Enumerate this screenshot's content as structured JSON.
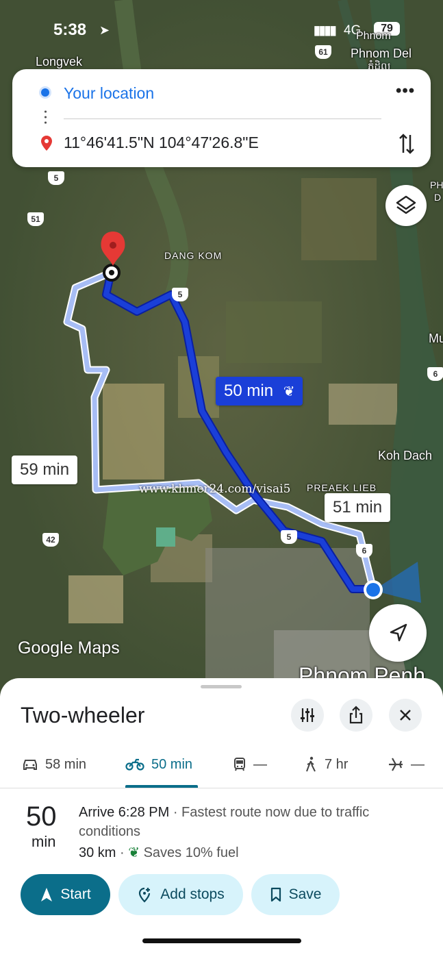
{
  "status_bar": {
    "time": "5:38",
    "network": "4G",
    "battery": "79"
  },
  "search": {
    "origin": "Your location",
    "destination": "11°46'41.5\"N 104°47'26.8\"E"
  },
  "map": {
    "places": {
      "longvek": "Longvek",
      "phnom_del": "Phnom Del",
      "phnom_del_khmer": "ភ្នំដិល",
      "phnom_top": "Phnom",
      "dang_kom": "DANG KOM",
      "koh_dach": "Koh Dach",
      "preaek_lieb": "PREAEK LIEB",
      "edge_ph": "PH",
      "edge_d": "D",
      "edge_mu": "Mu",
      "phnom_penh": "Phnom Penh"
    },
    "road_shields": {
      "r61": "61",
      "r5a": "5",
      "r51": "51",
      "r5b": "5",
      "r6a": "6",
      "r42": "42",
      "r5c": "5",
      "r6b": "6"
    },
    "route_times": {
      "main": "50 min",
      "alt1": "59 min",
      "alt2": "51 min"
    },
    "watermark": "www.khmer24.com/visai5",
    "logo": "Google Maps",
    "colors": {
      "main_route": "#1a3fd8",
      "alt_route": "#a7bdf5",
      "destination_pin": "#e53935",
      "origin_dot": "#1a73e8"
    }
  },
  "sheet": {
    "title": "Two-wheeler",
    "tabs": [
      {
        "icon": "car-icon",
        "label": "58 min"
      },
      {
        "icon": "motorcycle-icon",
        "label": "50 min"
      },
      {
        "icon": "transit-icon",
        "label": "—"
      },
      {
        "icon": "walk-icon",
        "label": "7 hr"
      },
      {
        "icon": "flight-icon",
        "label": "—"
      }
    ],
    "active_tab": "50 min",
    "duration_num": "50",
    "duration_unit": "min",
    "arrive": "Arrive 6:28 PM",
    "summary": " · Fastest route now due to traffic conditions",
    "distance": "30 km",
    "fuel_saving": "Saves 10% fuel",
    "buttons": {
      "start": "Start",
      "add_stops": "Add stops",
      "save": "Save"
    },
    "accent": "#0b6e8a"
  }
}
